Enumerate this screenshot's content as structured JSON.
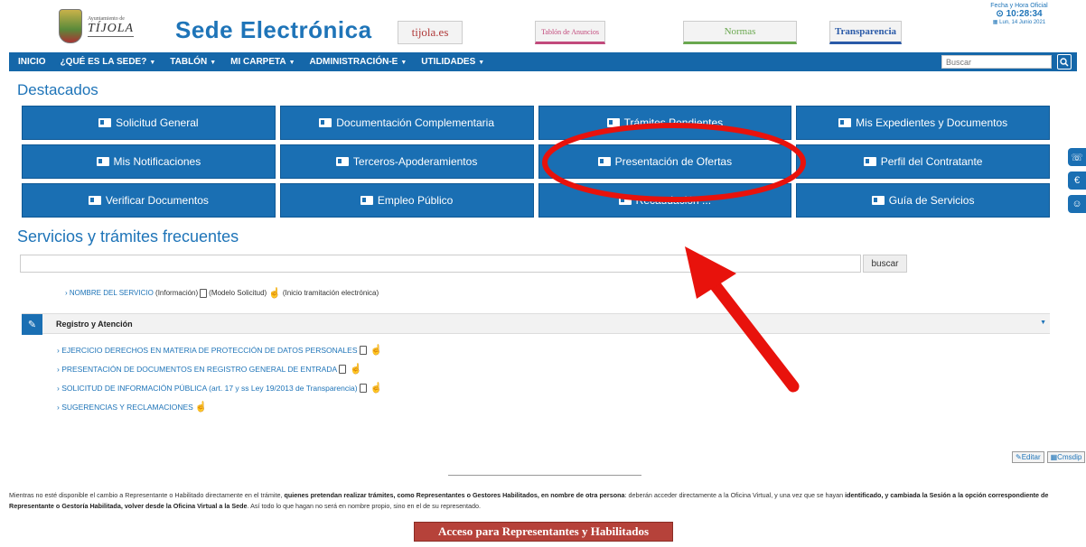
{
  "header": {
    "logo_small": "Ayuntamiento de",
    "logo_big": "TÍJOLA",
    "title": "Sede Electrónica",
    "links": [
      "tijola.es",
      "Tablón de Anuncios",
      "Normas",
      "Transparencia"
    ],
    "clock_label": "Fecha y Hora Oficial",
    "clock_time": "10:28:34",
    "clock_date": "Lun, 14 Junio 2021"
  },
  "nav": {
    "items": [
      "INICIO",
      "¿QUÉ ES LA SEDE?",
      "TABLÓN",
      "MI CARPETA",
      "ADMINISTRACIÓN-E",
      "UTILIDADES"
    ],
    "search_placeholder": "Buscar"
  },
  "destacados": {
    "title": "Destacados",
    "tiles": [
      "Solicitud General",
      "Documentación Complementaria",
      "Trámites Pendientes",
      "Mis Expedientes y Documentos",
      "Mis Notificaciones",
      "Terceros-Apoderamientos",
      "Presentación de Ofertas",
      "Perfil del Contratante",
      "Verificar Documentos",
      "Empleo Público",
      "Recaudación ...",
      "Guía de Servicios"
    ]
  },
  "services": {
    "title": "Servicios y trámites frecuentes",
    "search_button": "buscar",
    "legend": {
      "name": "› NOMBRE DEL SERVICIO",
      "info": "(Información)",
      "model": "(Modelo Solicitud)",
      "start": "(Inicio tramitación electrónica)"
    },
    "category": "Registro y Atención",
    "items": [
      "› EJERCICIO DERECHOS EN MATERIA DE PROTECCIÓN DE DATOS PERSONALES",
      "› PRESENTACIÓN DE DOCUMENTOS EN REGISTRO GENERAL DE ENTRADA",
      "› SOLICITUD DE INFORMACIÓN PÚBLICA (art. 17 y ss Ley 19/2013 de Transparencia)",
      "› SUGERENCIAS Y RECLAMACIONES"
    ],
    "edit_label": "Editar",
    "cmsdip_label": "Cmsdip"
  },
  "notice": {
    "p1": "Mientras no esté disponible el cambio a Representante o Habilitado directamente en el trámite,",
    "b1": " quienes pretendan realizar trámites, como Representantes o Gestores Habilitados, en nombre de otra persona",
    "p2": ": deberán acceder directamente a la Oficina Virtual, y una vez que se hayan",
    "b2": " identificado, y cambiada la Sesión a la opción correspondiente de Representante o Gestoría Habilitada, volver desde la Oficina Virtual a la Sede",
    "p3": ". Así todo lo que hagan no será en nombre propio, sino en el de su representado.",
    "button": "Acceso para Representantes y Habilitados"
  },
  "colors": {
    "primary": "#1a6fb3",
    "nav": "#1567a9",
    "annotation": "#e8120c",
    "access_button": "#b6423a"
  }
}
